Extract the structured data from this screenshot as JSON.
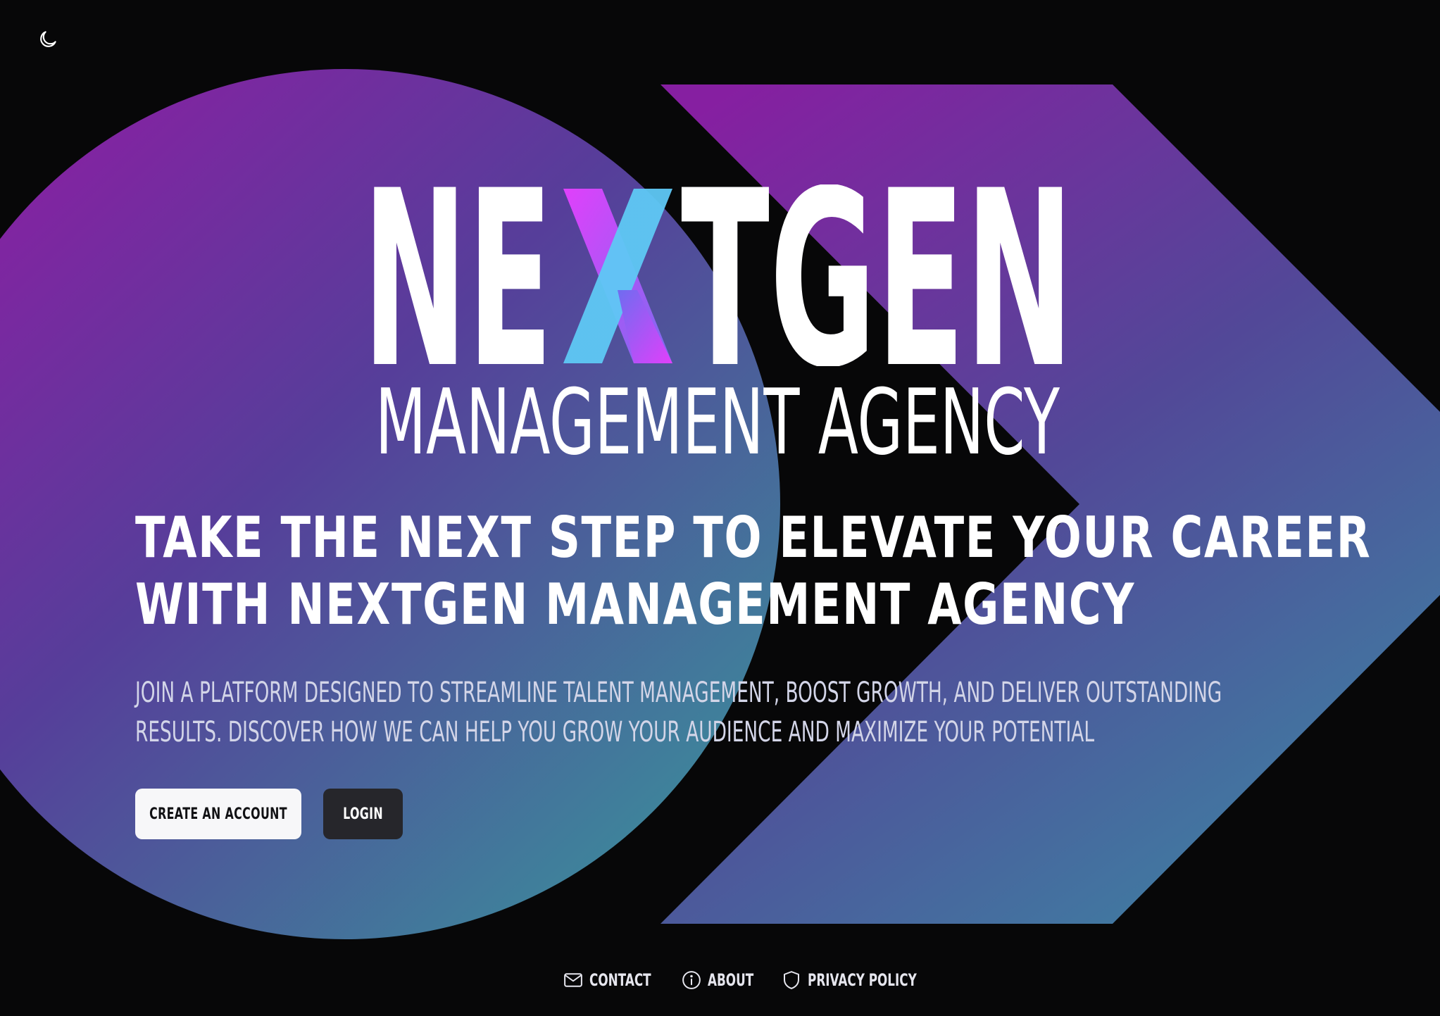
{
  "theme_toggle": {
    "icon": "moon-icon"
  },
  "logo": {
    "word_parts": [
      "NE",
      "X",
      "TGEN"
    ],
    "subtitle": "MANAGEMENT AGENCY"
  },
  "hero": {
    "headline_lines": [
      "TAKE THE NEXT STEP TO ELEVATE YOUR CAREER",
      "WITH NEXTGEN MANAGEMENT AGENCY"
    ],
    "subtext_lines": [
      "JOIN A PLATFORM DESIGNED TO STREAMLINE TALENT MANAGEMENT, BOOST GROWTH, AND DELIVER OUTSTANDING",
      "RESULTS. DISCOVER HOW WE CAN HELP YOU GROW YOUR AUDIENCE AND MAXIMIZE YOUR POTENTIAL"
    ],
    "primary_button": "CREATE AN ACCOUNT",
    "secondary_button": "LOGIN"
  },
  "footer": {
    "links": [
      {
        "label": "CONTACT",
        "icon": "mail-icon"
      },
      {
        "label": "ABOUT",
        "icon": "info-icon"
      },
      {
        "label": "PRIVACY POLICY",
        "icon": "shield-icon"
      }
    ]
  },
  "colors": {
    "background": "#070708",
    "gradient_magenta": "#8a1fa3",
    "gradient_violet": "#5a3b9c",
    "gradient_teal": "#3d8a9c",
    "x_pink": "#e040fb",
    "x_cyan": "#5ec8f5",
    "button_light": "#f7f7f9",
    "button_dark": "#26262b"
  }
}
